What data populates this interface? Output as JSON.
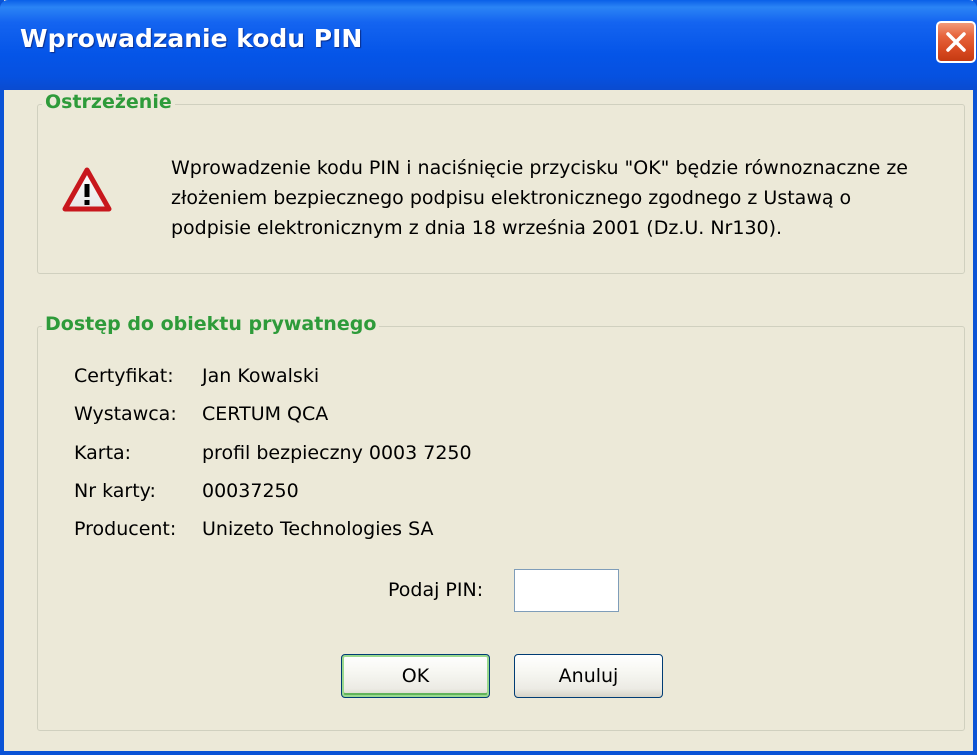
{
  "window": {
    "title": "Wprowadzanie kodu PIN"
  },
  "warning": {
    "legend": "Ostrzeżenie",
    "icon": "warning-triangle-icon",
    "lines": [
      "Wprowadzenie kodu PIN i naciśnięcie przycisku \"OK\" będzie równoznaczne ze",
      "złożeniem bezpiecznego podpisu elektronicznego zgodnego z Ustawą o",
      "podpisie elektronicznym z dnia 18 września 2001 (Dz.U. Nr130)."
    ]
  },
  "access": {
    "legend": "Dostęp do obiektu prywatnego",
    "rows": [
      {
        "label": "Certyfikat:",
        "value": "Jan Kowalski"
      },
      {
        "label": "Wystawca:",
        "value": "CERTUM QCA"
      },
      {
        "label": "Karta:",
        "value": "profil bezpieczny 0003 7250"
      },
      {
        "label": "Nr karty:",
        "value": "00037250"
      },
      {
        "label": "Producent:",
        "value": "Unizeto Technologies SA"
      }
    ],
    "pin_label": "Podaj PIN:",
    "pin_value": ""
  },
  "buttons": {
    "ok": "OK",
    "cancel": "Anuluj"
  },
  "colors": {
    "titlebar": "#0555e8",
    "legend": "#2e9b3a",
    "dialog_bg": "#ece9d8",
    "close_button": "#d84a21"
  }
}
